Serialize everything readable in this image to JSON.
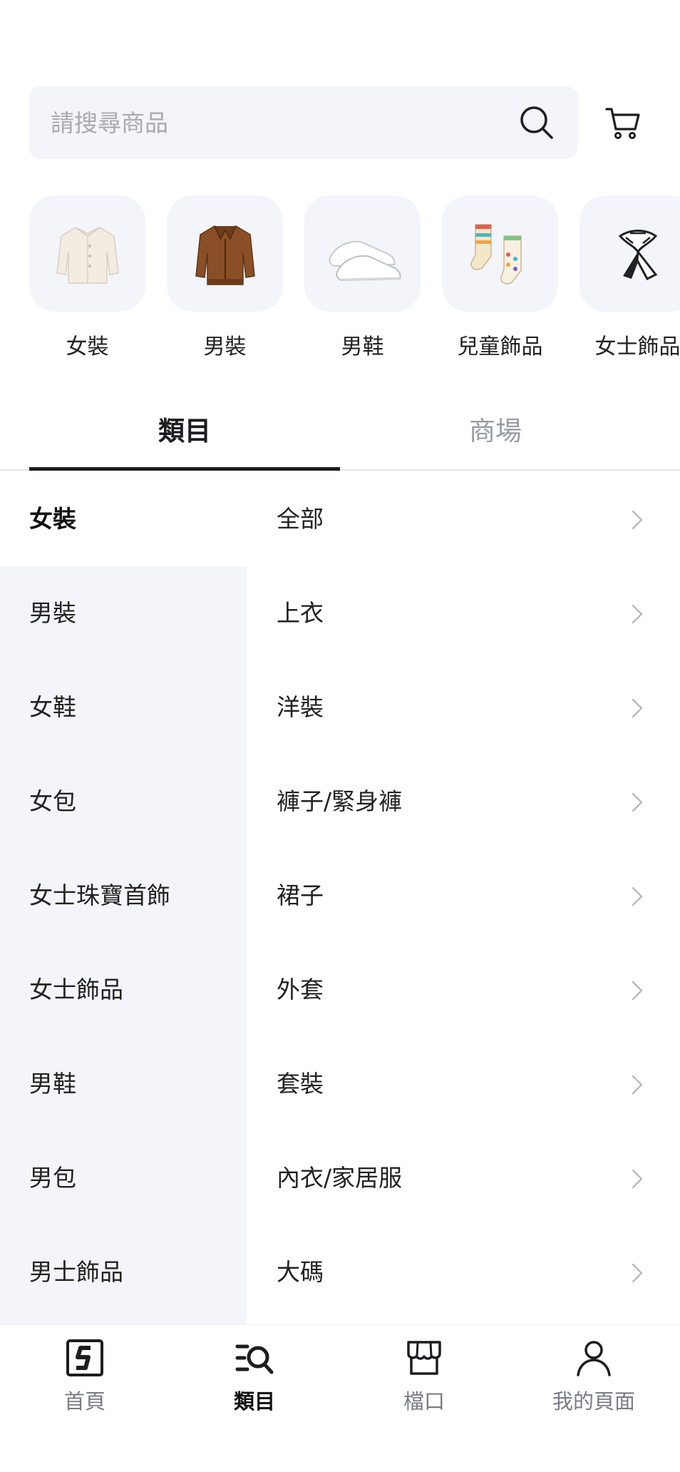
{
  "search": {
    "placeholder": "請搜尋商品"
  },
  "quick_categories": [
    {
      "label": "女裝",
      "icon": "cardigan-image"
    },
    {
      "label": "男裝",
      "icon": "leather-jacket-image"
    },
    {
      "label": "男鞋",
      "icon": "sneaker-image"
    },
    {
      "label": "兒童飾品",
      "icon": "socks-image"
    },
    {
      "label": "女士飾品",
      "icon": "scarf-image"
    }
  ],
  "tabs": [
    {
      "label": "類目",
      "active": true
    },
    {
      "label": "商場",
      "active": false
    }
  ],
  "left_categories": [
    {
      "label": "女裝",
      "active": true
    },
    {
      "label": "男裝"
    },
    {
      "label": "女鞋"
    },
    {
      "label": "女包"
    },
    {
      "label": "女士珠寶首飾"
    },
    {
      "label": "女士飾品"
    },
    {
      "label": "男鞋"
    },
    {
      "label": "男包"
    },
    {
      "label": "男士飾品"
    }
  ],
  "sub_categories": [
    {
      "label": "全部"
    },
    {
      "label": "上衣"
    },
    {
      "label": "洋裝"
    },
    {
      "label": "褲子/緊身褲"
    },
    {
      "label": "裙子"
    },
    {
      "label": "外套"
    },
    {
      "label": "套裝"
    },
    {
      "label": "內衣/家居服"
    },
    {
      "label": "大碼"
    }
  ],
  "bottom_nav": [
    {
      "label": "首頁",
      "icon": "home-s-icon",
      "active": false
    },
    {
      "label": "類目",
      "icon": "category-search-icon",
      "active": true
    },
    {
      "label": "檔口",
      "icon": "store-icon",
      "active": false
    },
    {
      "label": "我的頁面",
      "icon": "profile-icon",
      "active": false
    }
  ],
  "colors": {
    "panel_bg": "#f4f5fa",
    "active_text": "#1d1d1f",
    "muted_text": "#9a9ba2"
  }
}
